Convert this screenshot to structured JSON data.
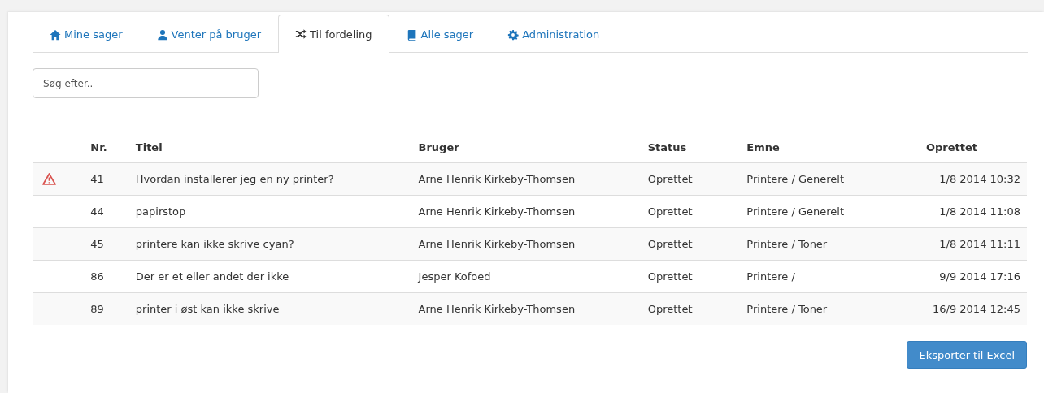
{
  "tabs": [
    {
      "label": "Mine sager",
      "kind": "home",
      "selected": false
    },
    {
      "label": "Venter på bruger",
      "kind": "user",
      "selected": false
    },
    {
      "label": "Til fordeling",
      "kind": "shuffle",
      "selected": true
    },
    {
      "label": "Alle sager",
      "kind": "book",
      "selected": false
    },
    {
      "label": "Administration",
      "kind": "gear",
      "selected": false
    }
  ],
  "search": {
    "placeholder": "Søg efter.."
  },
  "table": {
    "columns": [
      "Nr.",
      "Titel",
      "Bruger",
      "Status",
      "Emne",
      "Oprettet"
    ],
    "rows": [
      {
        "warning": true,
        "cells": [
          "41",
          "Hvordan installerer jeg en ny printer?",
          "Arne Henrik Kirkeby-Thomsen",
          "Oprettet",
          "Printere / Generelt",
          "1/8 2014 10:32"
        ]
      },
      {
        "warning": false,
        "cells": [
          "44",
          "papirstop",
          "Arne Henrik Kirkeby-Thomsen",
          "Oprettet",
          "Printere / Generelt",
          "1/8 2014 11:08"
        ]
      },
      {
        "warning": false,
        "cells": [
          "45",
          "printere kan ikke skrive cyan?",
          "Arne Henrik Kirkeby-Thomsen",
          "Oprettet",
          "Printere / Toner",
          "1/8 2014 11:11"
        ]
      },
      {
        "warning": false,
        "cells": [
          "86",
          "Der er et eller andet der ikke",
          "Jesper Kofoed",
          "Oprettet",
          "Printere /",
          "9/9 2014 17:16"
        ]
      },
      {
        "warning": false,
        "cells": [
          "89",
          "printer i øst kan ikke skrive",
          "Arne Henrik Kirkeby-Thomsen",
          "Oprettet",
          "Printere / Toner",
          "16/9 2014 12:45"
        ]
      }
    ]
  },
  "export_button": "Eksporter til Excel"
}
